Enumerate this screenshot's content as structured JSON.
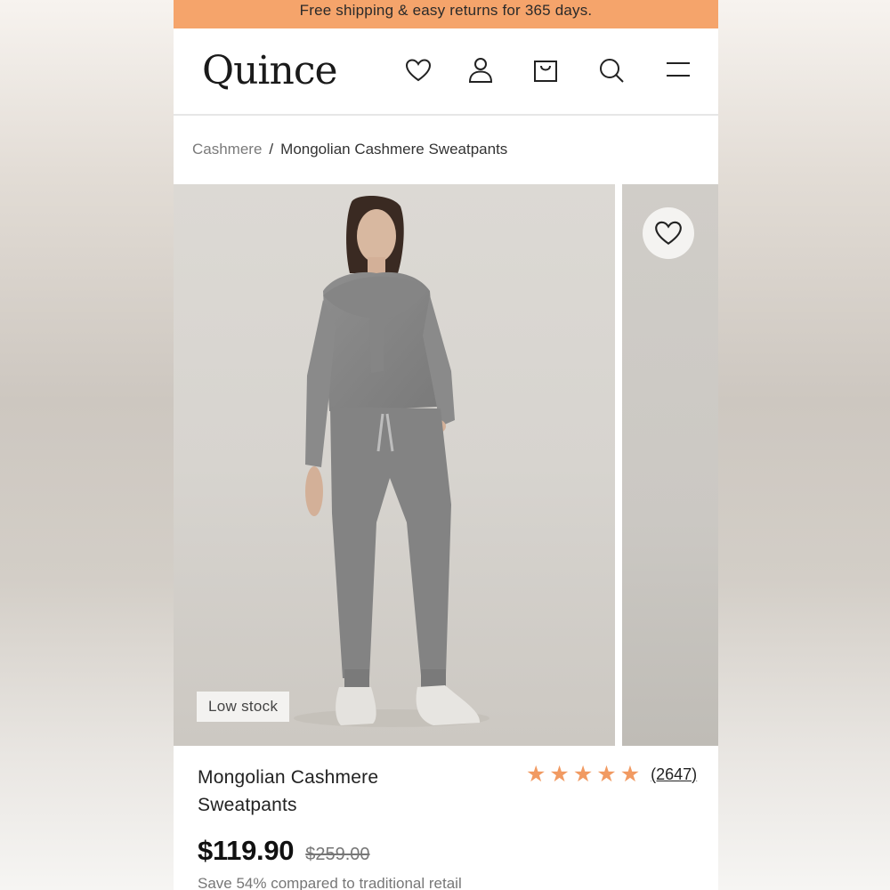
{
  "promo": {
    "text": "Free shipping & easy returns for 365 days."
  },
  "header": {
    "logo": "Quince",
    "icons": [
      "heart-icon",
      "account-icon",
      "bag-icon",
      "search-icon",
      "menu-icon"
    ]
  },
  "breadcrumb": {
    "parent": "Cashmere",
    "separator": "/",
    "current": "Mongolian Cashmere Sweatpants"
  },
  "gallery": {
    "badge": "Low stock",
    "photo_alt": "Model wearing grey cashmere sweater and sweatpants"
  },
  "product": {
    "title": "Mongolian Cashmere Sweatpants",
    "rating_stars": 5,
    "review_count": "(2647)",
    "price": "$119.90",
    "original_price": "$259.00",
    "savings_text": "Save 54% compared to traditional retail"
  },
  "colors": {
    "promo_bg": "#f5a46b",
    "star": "#f19a62"
  }
}
